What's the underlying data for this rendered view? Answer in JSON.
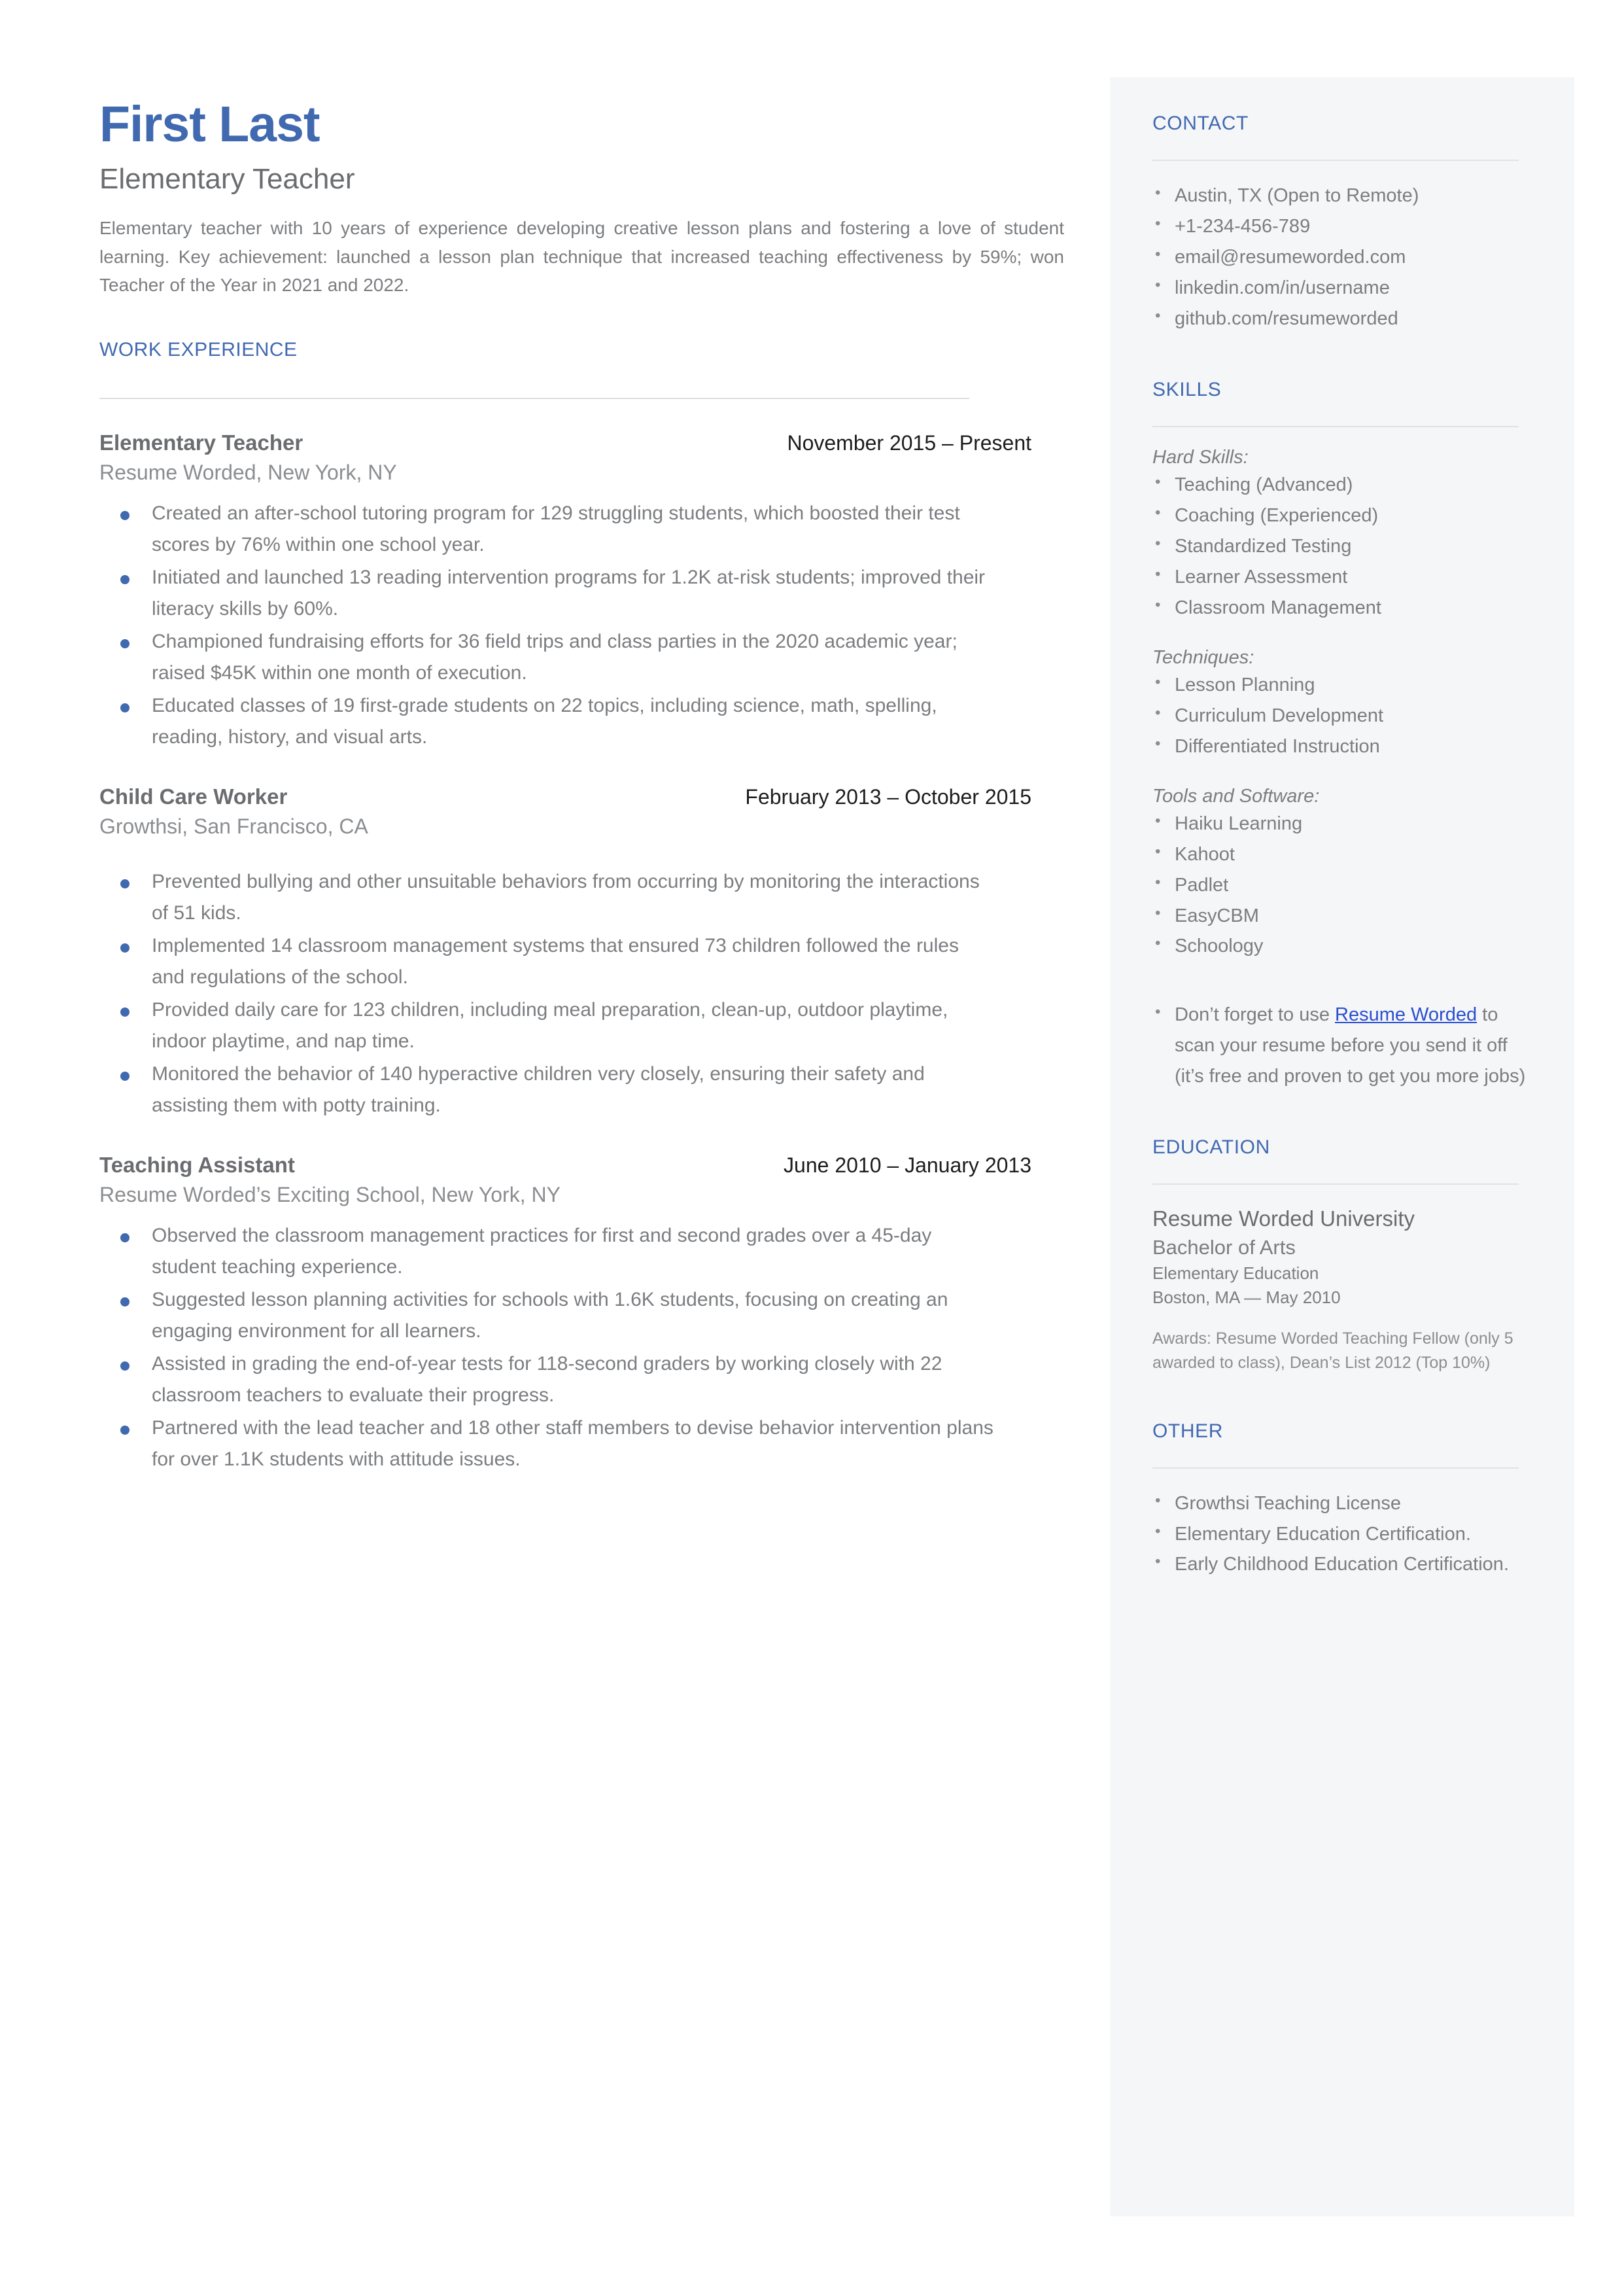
{
  "theme": {
    "accent_blue": "#4169b0",
    "link_blue": "#2a4fd0",
    "body_gray": "#7b7d80",
    "heading_gray": "#6a6c6f",
    "sidebar_bg": "#f5f6f8",
    "rule_gray": "#dcdee0"
  },
  "header": {
    "name": "First Last",
    "title": "Elementary Teacher",
    "summary": "Elementary teacher with 10 years of experience developing creative lesson plans and fostering a love of student learning. Key achievement: launched a lesson plan technique that increased teaching effectiveness by 59%; won Teacher of the Year in 2021 and 2022."
  },
  "work_experience": {
    "section_title": "WORK EXPERIENCE",
    "jobs": [
      {
        "title": "Elementary Teacher",
        "dates": "November 2015 – Present",
        "company": "Resume Worded, New York, NY",
        "bullets": [
          "Created an after-school tutoring program for 129 struggling students, which boosted their test scores by 76% within one school year.",
          "Initiated and launched 13 reading intervention programs for 1.2K at-risk students; improved their literacy skills by 60%.",
          "Championed fundraising efforts for 36 field trips and class parties in the 2020 academic year; raised $45K within one month of execution.",
          "Educated classes of 19 first-grade students on 22 topics, including science, math, spelling, reading, history, and visual arts."
        ]
      },
      {
        "title": "Child Care Worker",
        "dates": "February 2013 – October 2015",
        "company": "Growthsi, San Francisco, CA",
        "bullets": [
          "Prevented bullying and other unsuitable behaviors from occurring by monitoring the interactions of 51 kids.",
          "Implemented 14 classroom management systems that ensured 73 children followed the rules and regulations of the school.",
          "Provided daily care for 123 children, including meal preparation, clean-up, outdoor playtime, indoor playtime, and nap time.",
          "Monitored the behavior of 140 hyperactive children very closely, ensuring their safety and assisting them with potty training."
        ]
      },
      {
        "title": "Teaching Assistant",
        "dates": "June 2010 – January 2013",
        "company": "Resume Worded’s Exciting School, New York, NY",
        "bullets": [
          "Observed the classroom management practices for first and second grades over a 45-day student teaching experience.",
          "Suggested lesson planning activities for schools with 1.6K students, focusing on creating an engaging environment for all learners.",
          "Assisted in grading the end-of-year tests for 118-second graders by working closely with 22 classroom teachers to evaluate their progress.",
          "Partnered with the lead teacher and 18 other staff members to devise behavior intervention plans for over 1.1K students with attitude issues."
        ]
      }
    ]
  },
  "sidebar": {
    "contact": {
      "section_title": "CONTACT",
      "items": [
        "Austin, TX (Open to Remote)",
        "+1-234-456-789",
        "email@resumeworded.com",
        "linkedin.com/in/username",
        "github.com/resumeworded"
      ]
    },
    "skills": {
      "section_title": "SKILLS",
      "groups": [
        {
          "label": "Hard Skills:",
          "items": [
            "Teaching (Advanced)",
            "Coaching (Experienced)",
            "Standardized Testing",
            "Learner Assessment",
            "Classroom Management"
          ]
        },
        {
          "label": "Techniques:",
          "items": [
            "Lesson Planning",
            "Curriculum Development",
            "Differentiated Instruction"
          ]
        },
        {
          "label": "Tools and Software:",
          "items": [
            "Haiku Learning",
            "Kahoot",
            "Padlet",
            "EasyCBM",
            "Schoology"
          ]
        }
      ],
      "promo": {
        "prefix": "Don’t forget to use ",
        "link_text": "Resume Worded",
        "suffix": " to scan your resume before you send it off (it’s free and proven to get you more jobs)"
      }
    },
    "education": {
      "section_title": "EDUCATION",
      "school": "Resume Worded University",
      "degree": "Bachelor of Arts",
      "field": "Elementary Education",
      "location_date": "Boston, MA — May 2010",
      "awards": "Awards: Resume Worded Teaching Fellow (only 5 awarded to class), Dean’s List 2012 (Top 10%)"
    },
    "other": {
      "section_title": "OTHER",
      "items": [
        "Growthsi Teaching License",
        "Elementary Education Certification.",
        "Early Childhood Education Certification."
      ]
    }
  }
}
